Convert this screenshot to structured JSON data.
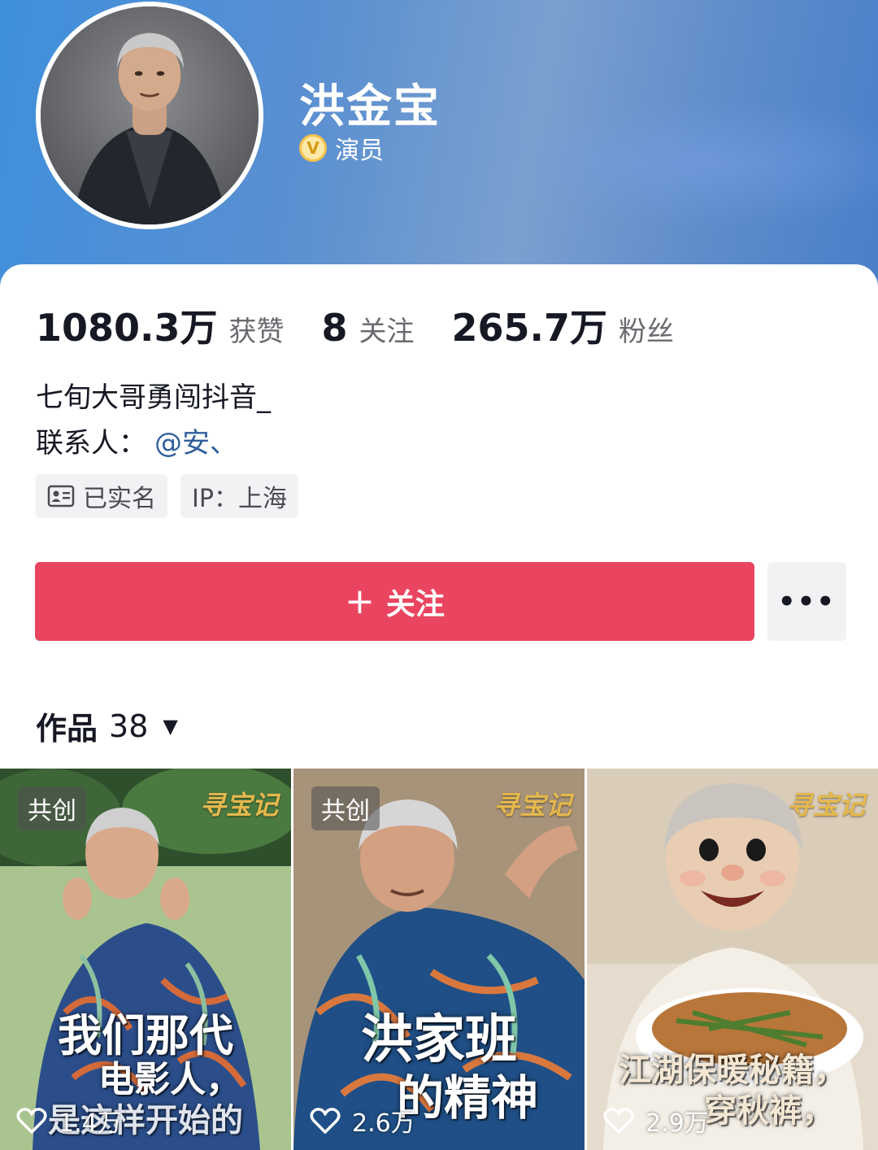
{
  "profile": {
    "name": "洪金宝",
    "verified_title": "演员",
    "verify_badge": "V"
  },
  "stats": [
    {
      "value": "1080.3万",
      "label": "获赞"
    },
    {
      "value": "8",
      "label": "关注"
    },
    {
      "value": "265.7万",
      "label": "粉丝"
    }
  ],
  "bio": {
    "line1": "七旬大哥勇闯抖音_",
    "contact_prefix": "联系人：",
    "contact_link": "@安、"
  },
  "tags": {
    "real_name": "已实名",
    "ip": "IP：上海"
  },
  "actions": {
    "follow_plus": "+",
    "follow_label": "关注",
    "more_label": "•••"
  },
  "works": {
    "label": "作品",
    "count": "38",
    "caret": "▼",
    "items": [
      {
        "badge": "共创",
        "brand": "寻宝记",
        "caption1": "我们那代",
        "caption2": "电影人，",
        "caption3": "是这样开始的",
        "likes": "1.4万"
      },
      {
        "badge": "共创",
        "brand": "寻宝记",
        "caption1": "洪家班",
        "caption2": "的精神",
        "likes": "2.6万"
      },
      {
        "brand": "寻宝记",
        "caption1": "江湖保暖秘籍，",
        "caption2": "穿秋裤，",
        "likes": "2.9万"
      }
    ]
  },
  "colors": {
    "follow_button": "#ea4560",
    "link": "#2f5f9c",
    "brand_gold": "#e5b84c"
  }
}
